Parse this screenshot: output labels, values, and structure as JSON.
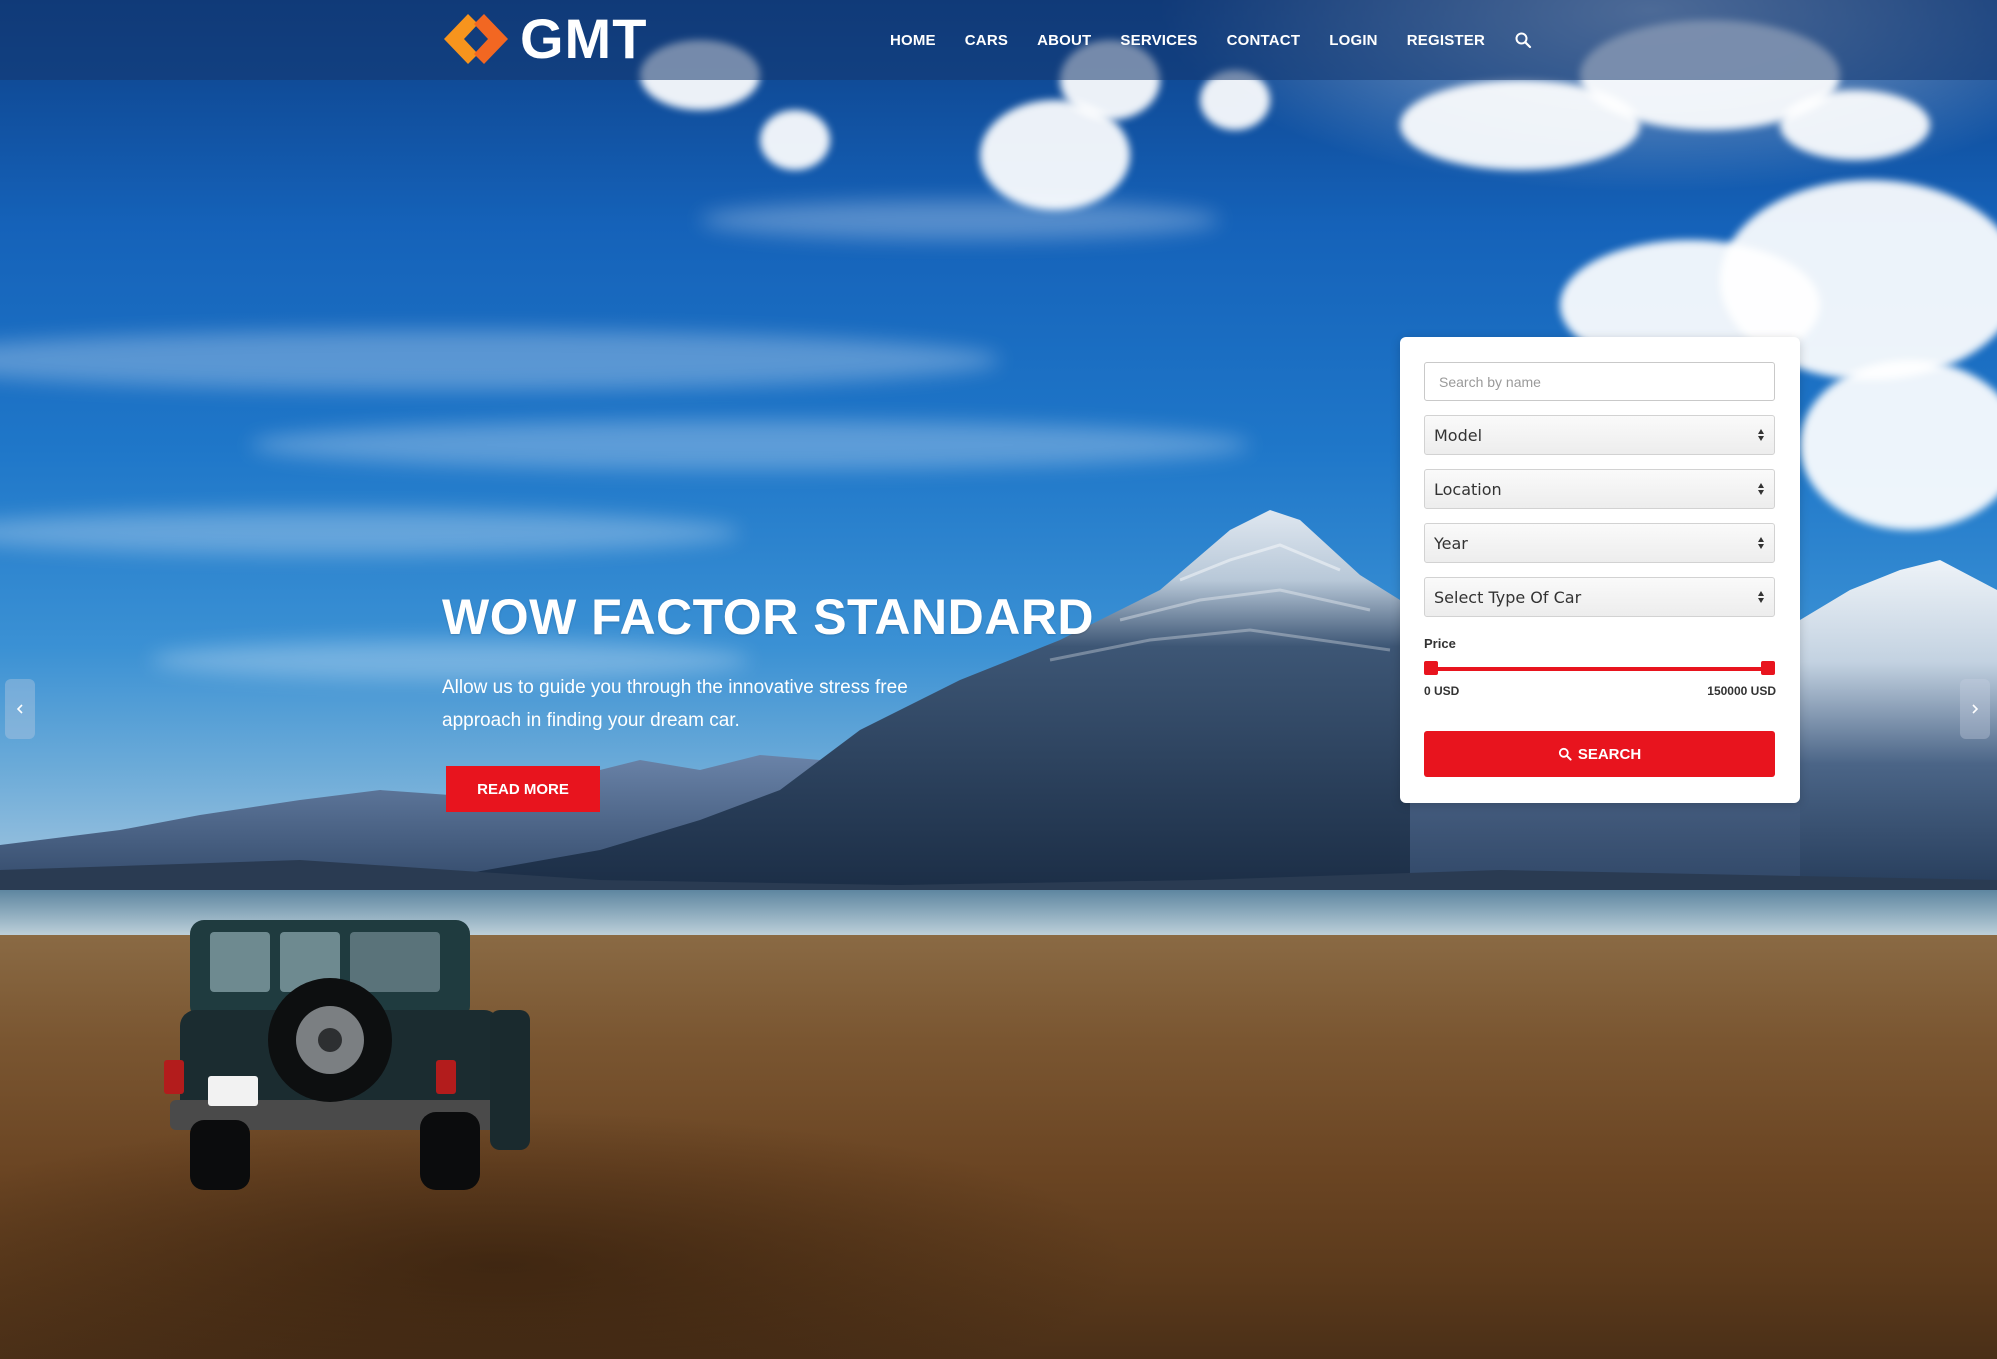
{
  "brand": {
    "name": "GMT",
    "logo_colors": [
      "#f7941d",
      "#f26722"
    ]
  },
  "nav": {
    "items": [
      {
        "label": "HOME"
      },
      {
        "label": "CARS"
      },
      {
        "label": "ABOUT"
      },
      {
        "label": "SERVICES"
      },
      {
        "label": "CONTACT"
      },
      {
        "label": "LOGIN"
      },
      {
        "label": "REGISTER"
      }
    ],
    "search_icon": "search-icon"
  },
  "hero": {
    "title": "WOW FACTOR STANDARD",
    "subtitle": "Allow us to guide you through the innovative stress free approach in finding your dream car.",
    "button_label": "READ MORE",
    "prev_icon": "chevron-left-icon",
    "next_icon": "chevron-right-icon"
  },
  "search_form": {
    "name_placeholder": "Search by name",
    "selects": [
      {
        "value": "Model"
      },
      {
        "value": "Location"
      },
      {
        "value": "Year"
      },
      {
        "value": "Select Type Of Car"
      }
    ],
    "price": {
      "label": "Price",
      "min_text": "0 USD",
      "max_text": "150000 USD",
      "selected_min": 0,
      "selected_max": 150000
    },
    "button_label": "SEARCH",
    "button_icon": "search-icon"
  },
  "colors": {
    "accent": "#e8141e",
    "nav_text": "#ffffff"
  }
}
